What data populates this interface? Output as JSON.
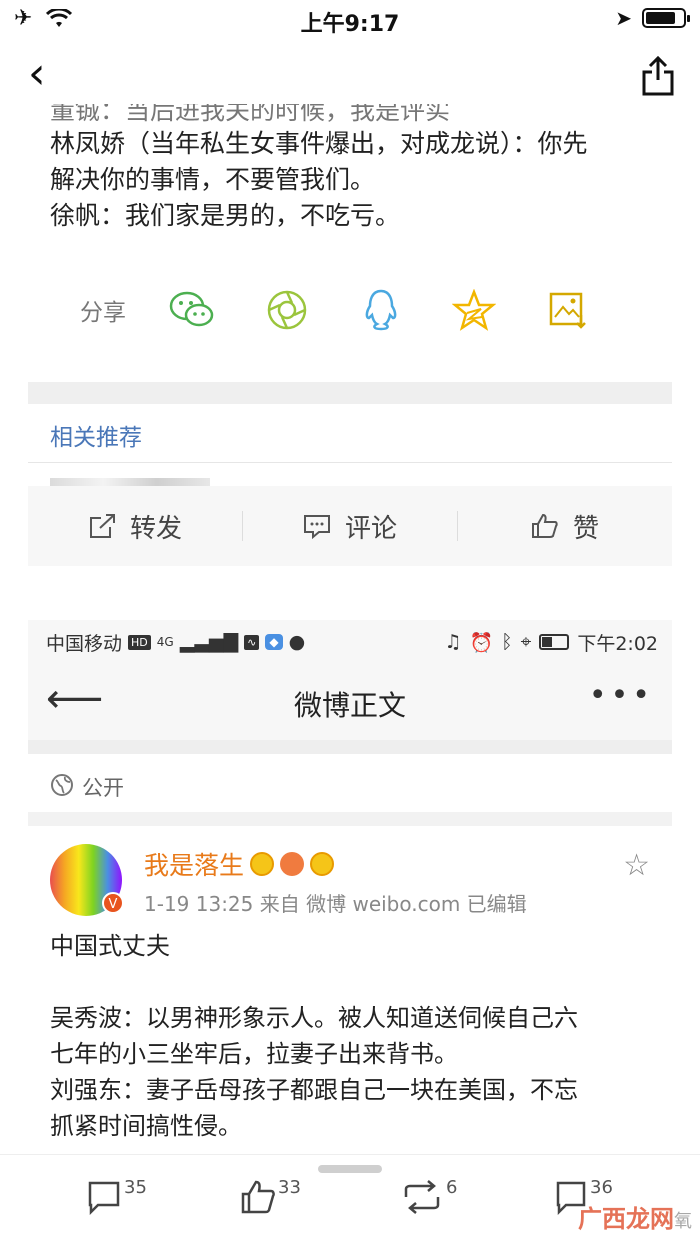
{
  "status_bar": {
    "time": "上午9:17"
  },
  "article": {
    "partial_line": "董铖：当后进我关的时候，我是评实",
    "lines": [
      "林凤娇（当年私生女事件爆出，对成龙说）：你先",
      "解决你的事情，不要管我们。",
      "徐帆：我们家是男的，不吃亏。"
    ]
  },
  "share": {
    "label": "分享",
    "icons": [
      "wechat-icon",
      "moments-icon",
      "qq-icon",
      "qzone-star-icon",
      "save-image-icon"
    ]
  },
  "related": {
    "title": "相关推荐"
  },
  "actions": {
    "repost": "转发",
    "comment": "评论",
    "like": "赞"
  },
  "embedded": {
    "status": {
      "carrier": "中国移动",
      "hd": "HD",
      "net": "4G",
      "time": "下午2:02"
    },
    "nav": {
      "title": "微博正文",
      "more": "•••"
    },
    "visibility": "公开",
    "post": {
      "username": "我是落生",
      "meta": "1-19 13:25  来自 微博 weibo.com  已编辑",
      "lines": [
        "中国式丈夫",
        "",
        "吴秀波：以男神形象示人。被人知道送伺候自己六",
        "七年的小三坐牢后，拉妻子出来背书。",
        "刘强东：妻子岳母孩子都跟自己一块在美国，不忘",
        "抓紧时间搞性侵。"
      ]
    }
  },
  "bottom_bar": {
    "comments": "35",
    "likes": "33",
    "reposts": "6",
    "bookmarks": "36"
  },
  "watermark": {
    "brand": "广西龙网",
    "suffix": "氧"
  },
  "colors": {
    "accent_link": "#4a77b8",
    "username": "#e87a1a",
    "wechat": "#4caf50",
    "star": "#f2b600"
  }
}
